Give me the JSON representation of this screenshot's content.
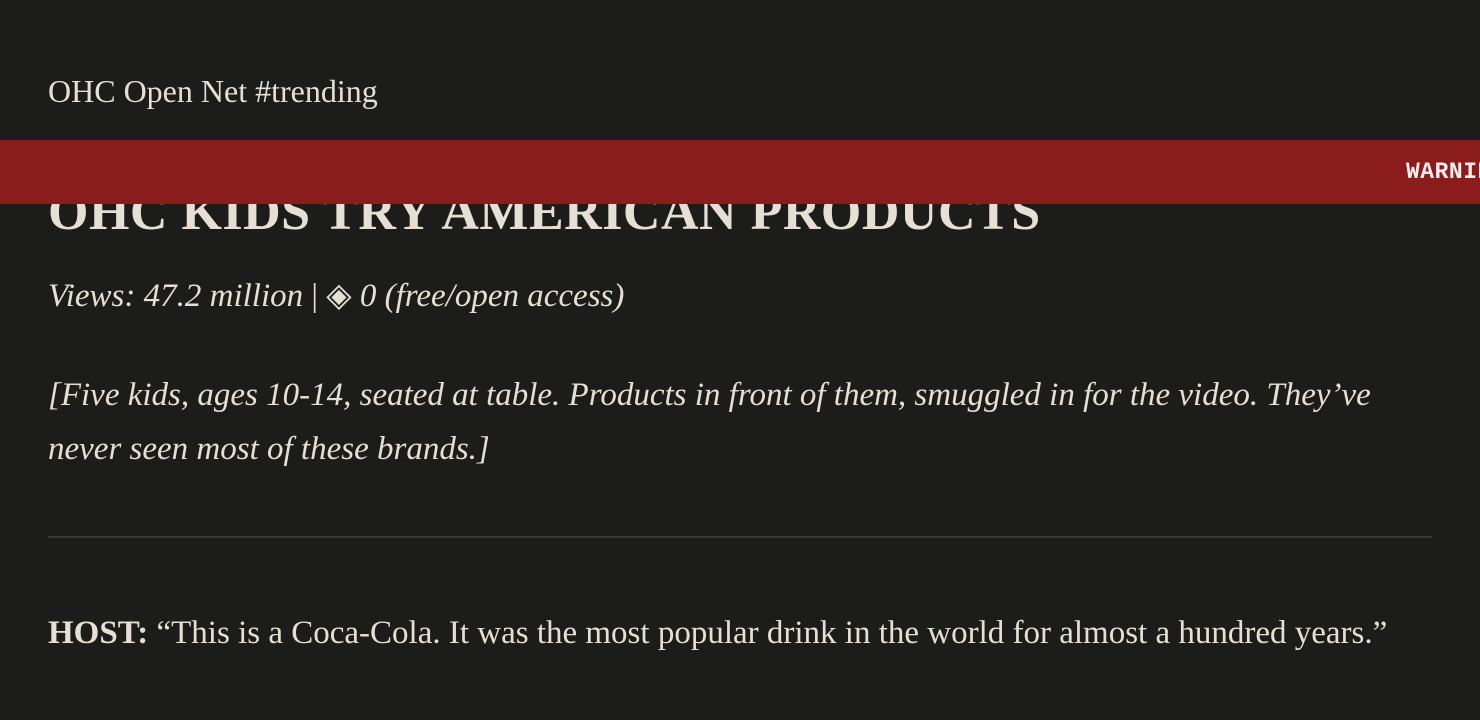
{
  "site": {
    "header": "OHC Open Net #trending"
  },
  "banner": {
    "text": "WARNING",
    "color": "#8b1c1d"
  },
  "video": {
    "title": "OHC KIDS TRY AMERICAN PRODUCTS",
    "views": "Views: 47.2 million",
    "separator": "|",
    "price_icon": "◈",
    "price": "0 (free/open access)",
    "stage_direction": "[Five kids, ages 10-14, seated at table. Products in front of them, smuggled in for the video. They’ve never seen most of these brands.]"
  },
  "transcript": [
    {
      "speaker": "HOST:",
      "line": "“This is a Coca-Cola. It was the most popular drink in the world for almost a hundred years.”"
    }
  ],
  "colors": {
    "background": "#1c1c1b",
    "text": "#e6e0d4",
    "divider": "#3a3937"
  }
}
